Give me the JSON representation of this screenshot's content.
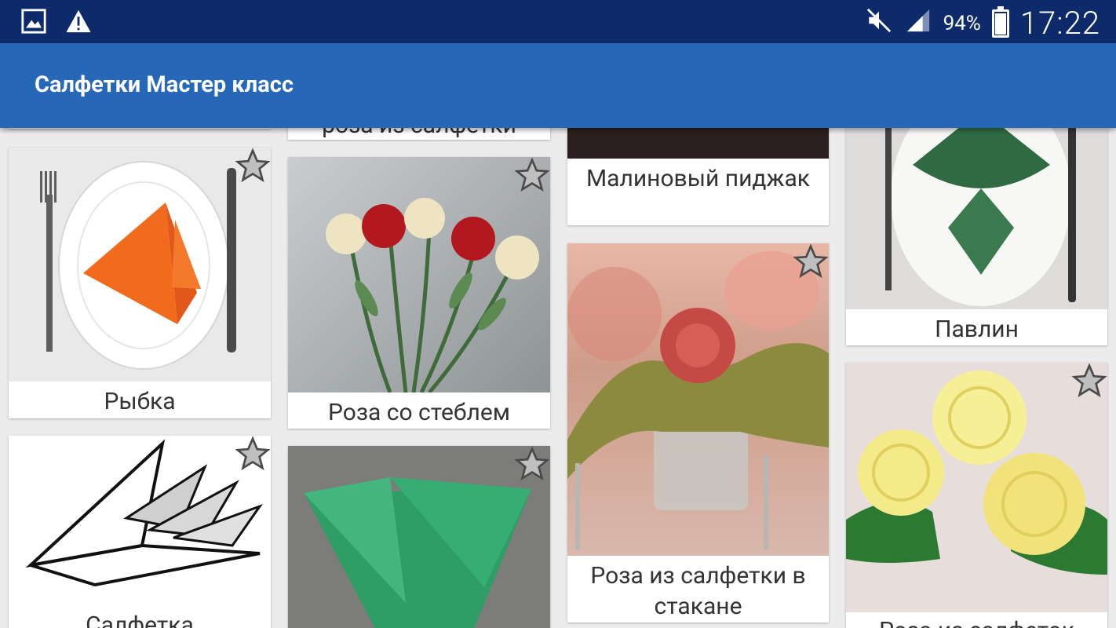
{
  "statusbar": {
    "battery": "94%",
    "time": "17:22"
  },
  "appbar": {
    "title": "Салфетки Мастер класс"
  },
  "cards": {
    "c1_top": {
      "caption": ""
    },
    "c2_top": {
      "caption": "роза из салфетки"
    },
    "c3_top": {
      "caption": "Малиновый пиджак"
    },
    "c4_top": {
      "caption": "Павлин"
    },
    "fish": {
      "caption": "Рыбка"
    },
    "rose_stem": {
      "caption": "Роза со стеблем"
    },
    "rose_glass": {
      "caption": "Роза из салфетки в стакане"
    },
    "yellow": {
      "caption": "Роза из салфеток"
    },
    "salfetka": {
      "caption": "Салфетка"
    },
    "green": {
      "caption": ""
    }
  },
  "colors": {
    "status": "#0d2b6b",
    "appbar": "#2767b8",
    "star": "#bfbfbf"
  }
}
